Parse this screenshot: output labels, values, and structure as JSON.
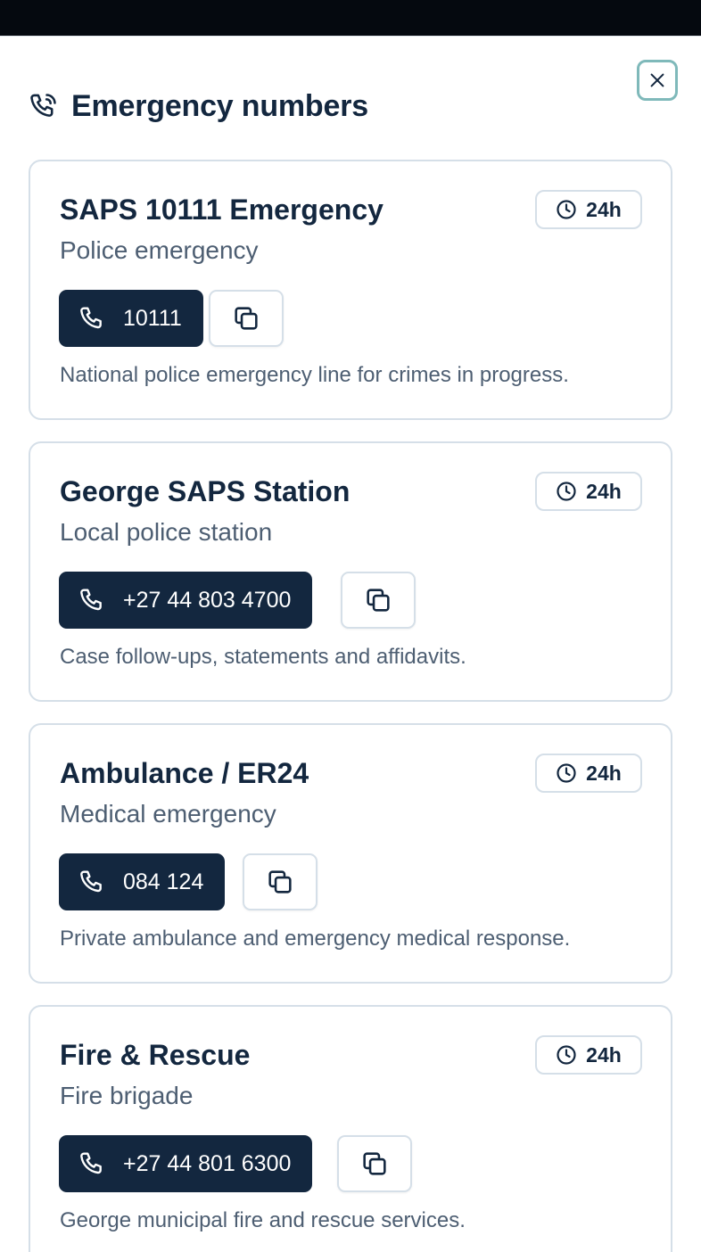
{
  "dialog": {
    "title": "Emergency numbers"
  },
  "contacts": [
    {
      "name": "SAPS 10111 Emergency",
      "type": "Police emergency",
      "hours": "24h",
      "number": "10111",
      "description": "National police emergency line for crimes in progress."
    },
    {
      "name": "George SAPS Station",
      "type": "Local police station",
      "hours": "24h",
      "number": "+27 44 803 4700",
      "description": "Case follow-ups, statements and affidavits."
    },
    {
      "name": "Ambulance / ER24",
      "type": "Medical emergency",
      "hours": "24h",
      "number": "084 124",
      "description": "Private ambulance and emergency medical response."
    },
    {
      "name": "Fire & Rescue",
      "type": "Fire brigade",
      "hours": "24h",
      "number": "+27 44 801 6300",
      "description": "George municipal fire and rescue services."
    }
  ],
  "icons": {
    "close": "close-icon",
    "header": "phone-wave-icon",
    "hours": "clock-icon",
    "call": "phone-icon",
    "copy": "copy-icon"
  },
  "colors": {
    "primary": "#13273f",
    "muted_text": "#4d5e72",
    "border": "#d5dfe8",
    "focus_ring": "#7fb9ba",
    "backdrop": "#05090f"
  }
}
